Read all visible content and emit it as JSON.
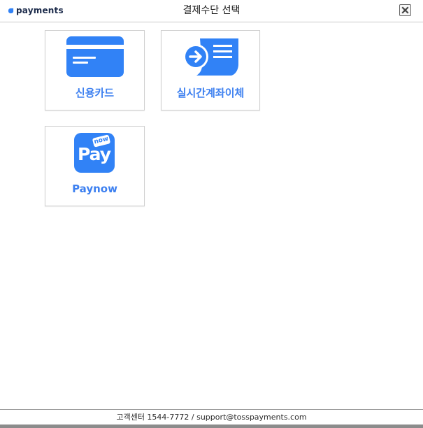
{
  "header": {
    "logo_text": "payments",
    "title": "결제수단 선택",
    "close_icon": "close-x-icon"
  },
  "methods": [
    {
      "label": "신용카드",
      "icon": "credit-card-icon"
    },
    {
      "label": "실시간계좌이체",
      "icon": "bank-transfer-icon"
    },
    {
      "label": "Paynow",
      "icon": "paynow-logo-icon",
      "icon_text": "Pay",
      "icon_badge": "now"
    }
  ],
  "footer": {
    "text": "고객센터 1544-7772 / support@tosspayments.com"
  },
  "colors": {
    "accent": "#3d80f0",
    "icon_blue": "#3182f6",
    "logo_navy": "#1b2a4a"
  }
}
